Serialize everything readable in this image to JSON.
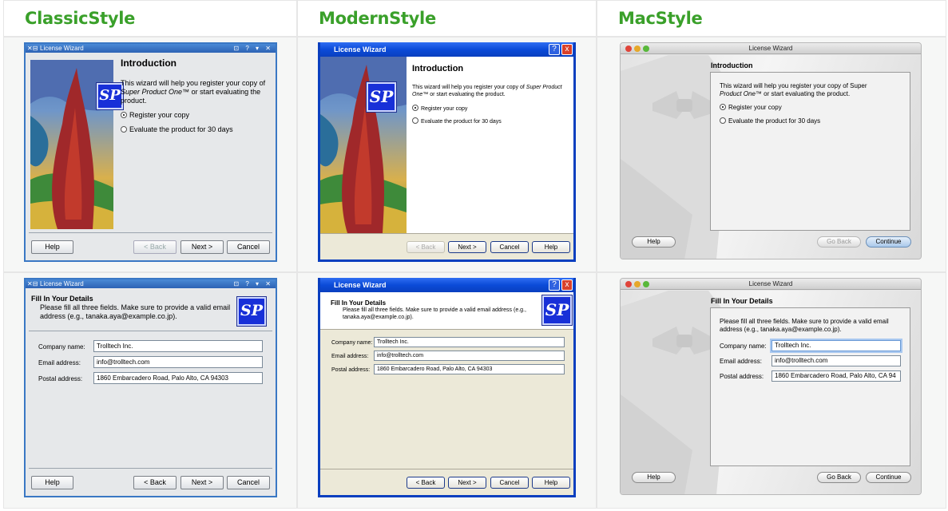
{
  "columns": [
    {
      "title": "ClassicStyle"
    },
    {
      "title": "ModernStyle"
    },
    {
      "title": "MacStyle"
    }
  ],
  "window_title": "License Wizard",
  "logo_text": "SP",
  "intro": {
    "heading": "Introduction",
    "desc_line1": "This wizard will help you register your copy of",
    "desc_product": "Super Product One™",
    "desc_line2": "or start evaluating the product.",
    "mac_desc_line1": "This wizard will help you register your copy of Super",
    "mac_desc_product": "Product One™",
    "option_register": "Register your copy",
    "option_evaluate": "Evaluate the product for 30 days",
    "selected_option": "register"
  },
  "details": {
    "heading": "Fill In Your Details",
    "desc_line1": "Please fill all three fields. Make sure to provide a valid email",
    "desc_line2": "address (e.g., tanaka.aya@example.co.jp).",
    "modern_desc_line1": "Please fill all three fields. Make sure to provide a valid email address (e.g.,",
    "modern_desc_line2": "tanaka.aya@example.co.jp).",
    "company_label": "Company name:",
    "email_label": "Email address:",
    "postal_label": "Postal address:",
    "company_value": "Trolltech Inc.",
    "email_value": "info@trolltech.com",
    "postal_value": "1860 Embarcadero Road, Palo Alto, CA 94303",
    "mac_postal_value": "1860 Embarcadero Road, Palo Alto, CA 94"
  },
  "buttons": {
    "help": "Help",
    "back": "< Back",
    "next": "Next >",
    "cancel": "Cancel",
    "go_back": "Go Back",
    "continue": "Continue"
  },
  "titlebar_controls": {
    "help": "?",
    "close": "x"
  },
  "colors": {
    "header_green": "#3aa02a",
    "classic_blue": "#3a78c4",
    "xp_blue": "#0a3fbf",
    "logo_blue": "#1830d8"
  }
}
